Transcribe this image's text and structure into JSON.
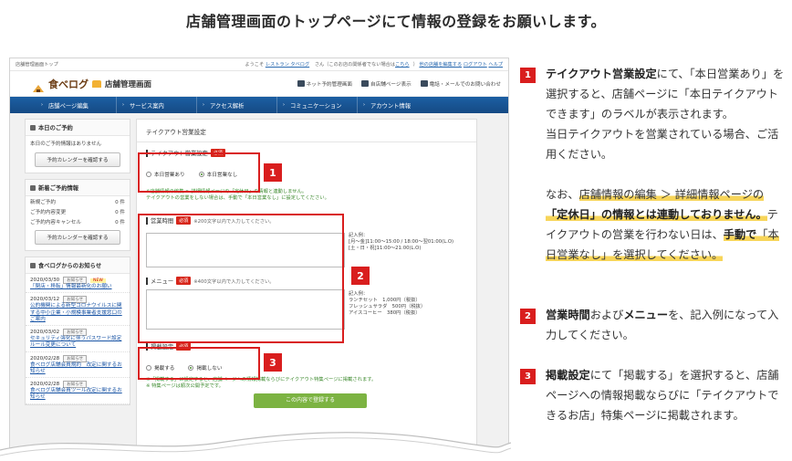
{
  "headline": "店舗管理画面のトップページにて情報の登録をお願いします。",
  "screenshot": {
    "topbar": {
      "left": "店舗管理画面トップ",
      "greeting": "ようこそ",
      "shop_link": "レストラン タベログ",
      "suffix": "さん（このお店の関係者でない場合は",
      "here_link": "こちら",
      "close_paren": "）",
      "other_shop": "他の店舗を編集する",
      "logout": "ログアウト",
      "help": "ヘルプ"
    },
    "brand": {
      "logo": "食べログ",
      "subtitle": "店舗管理画面"
    },
    "tools": [
      "ネット予約管理画面",
      "自店舗ページ表示",
      "電話・メールでのお問い合わせ"
    ],
    "nav": [
      "店舗ページ編集",
      "サービス案内",
      "アクセス解析",
      "コミュニケーション",
      "アカウント情報"
    ],
    "sidebar": {
      "today": {
        "title": "本日のご予約",
        "text": "本日のご予約情報はありません",
        "button": "予約カレンダーを確認する"
      },
      "new": {
        "title": "新着ご予約情報",
        "rows": [
          {
            "label": "新規ご予約",
            "count": "0 件"
          },
          {
            "label": "ご予約内容変更",
            "count": "0 件"
          },
          {
            "label": "ご予約内容キャンセル",
            "count": "0 件"
          }
        ],
        "button": "予約カレンダーを確認する"
      },
      "news": {
        "title": "食べログからのお知らせ",
        "tag": "お知らせ",
        "new_tag": "NEW",
        "items": [
          {
            "date": "2020/03/30",
            "text": "「閉店・移転」情報最新化のお願い"
          },
          {
            "date": "2020/03/12",
            "text": "公的機関による新型コロナウイルスに関する中小企業・小規模事業者支援窓口のご案内"
          },
          {
            "date": "2020/03/02",
            "text": "セキュリティ強化に伴うパスワード設定ルール変更について"
          },
          {
            "date": "2020/02/28",
            "text": "食べログ店舗会員規約　改定に関するお知らせ"
          },
          {
            "date": "2020/02/28",
            "text": "食べログ店舗会員ツール改定に関するお知らせ"
          }
        ]
      }
    },
    "form": {
      "title": "テイクアウト営業設定",
      "takeout_label": "テイクアウト営業設定",
      "required": "必須",
      "option_open": "本日営業あり",
      "option_closed": "本日営業なし",
      "takeout_note": "※店舗情報の編集 > 詳細情報ページの「定休日」の情報と連動しません。\nテイクアウトの営業をしない場合は、手動で「本日営業なし」に設定してください。",
      "hours_label": "営業時間",
      "hours_hint": "※200文字以内で入力してください。",
      "hours_example": "記入例：\n[月〜金]11:00〜15:00 / 18:00〜翌01:00(L.O)\n[土・日・祝]11:00〜21:00(L.O)",
      "menu_label": "メニュー",
      "menu_hint": "※400文字以内で入力してください。",
      "menu_example": "記入例：\nランチセット　1,000円（税抜）\nフレッシュサラダ　500円（税抜）\nアイスコーヒー　380円（税抜）",
      "publish_label": "掲載設定",
      "publish_yes": "掲載する",
      "publish_no": "掲載しない",
      "publish_note": "※「掲載する」に設定すると、店舗ページへの情報掲載ならびにテイクアウト特集ページに掲載されます。\n※ 特集ページは順次公開予定です。",
      "submit": "この内容で登録する"
    },
    "badges": [
      "1",
      "2",
      "3"
    ]
  },
  "instructions": {
    "s1": {
      "num": "1",
      "b1": "テイクアウト営業設定",
      "t1": "にて、「本日営業あり」を選択すると、店舗ページに「本日テイクアウトできます」のラベルが表示されます。",
      "t2": "当日テイクアウトを営業されている場合、ご活用ください。",
      "t3a": "なお、",
      "h1": "店舗情報の編集 ＞ 詳細情報ページの",
      "h2": "「定休日」の情報とは連動しておりません。",
      "t3b": "テイクアウトの営業を行わない日は、",
      "h3": "手動で",
      "h4": "「本日営業なし」を選択してください。"
    },
    "s2": {
      "num": "2",
      "b1": "営業時間",
      "t1": "および",
      "b2": "メニュー",
      "t2": "を、記入例になって入力してください。"
    },
    "s3": {
      "num": "3",
      "b1": "掲載設定",
      "t1": "にて「掲載する」を選択すると、店舗ページへの情報掲載ならびに「テイクアウトできるお店」特集ページに掲載されます。"
    }
  }
}
